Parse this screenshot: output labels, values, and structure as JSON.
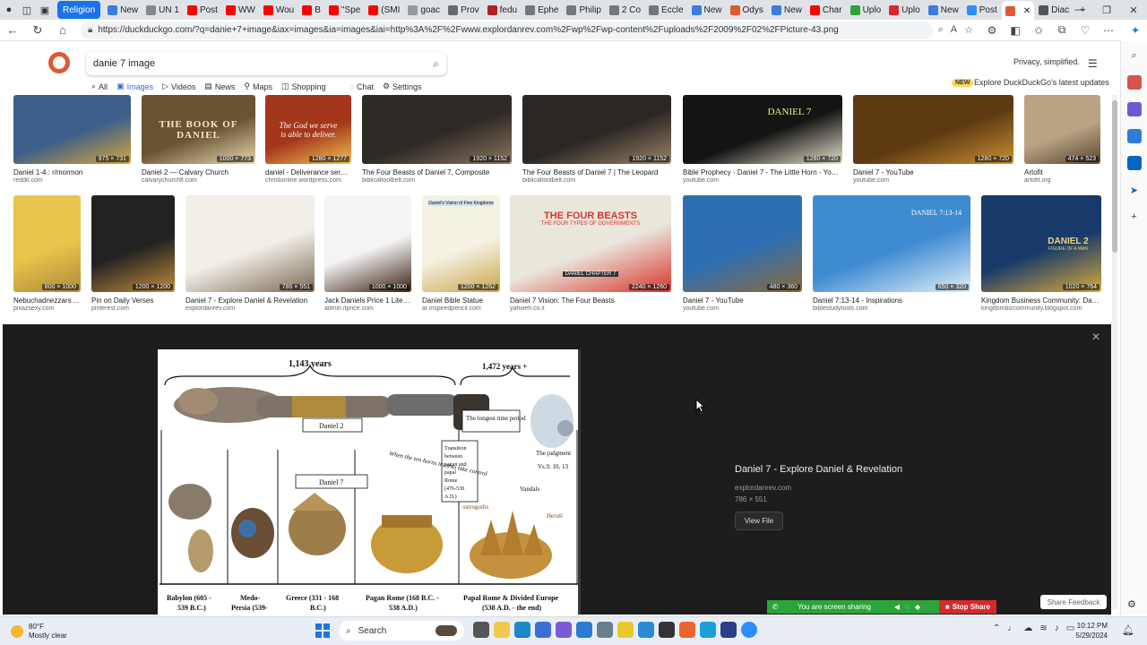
{
  "browser": {
    "tabs": [
      {
        "label": "Religion",
        "type": "group"
      },
      {
        "label": "New",
        "fav": "#3b7ddd"
      },
      {
        "label": "UN 1",
        "fav": "#888"
      },
      {
        "label": "Post",
        "fav": "#ff0000"
      },
      {
        "label": "WW",
        "fav": "#ff0000"
      },
      {
        "label": "Wou",
        "fav": "#ff0000"
      },
      {
        "label": "B",
        "fav": "#ff0000"
      },
      {
        "label": "\"Spe",
        "fav": "#ff0000"
      },
      {
        "label": "(SMI",
        "fav": "#ff0000"
      },
      {
        "label": "goac",
        "fav": "#999"
      },
      {
        "label": "Prov",
        "fav": "#6b6b6b"
      },
      {
        "label": "fedu",
        "fav": "#b02020"
      },
      {
        "label": "Ephe",
        "fav": "#777"
      },
      {
        "label": "Philip",
        "fav": "#777"
      },
      {
        "label": "2 Co",
        "fav": "#777"
      },
      {
        "label": "Eccle",
        "fav": "#777"
      },
      {
        "label": "New",
        "fav": "#3b7ddd"
      },
      {
        "label": "Odys",
        "fav": "#e05a2b"
      },
      {
        "label": "New",
        "fav": "#3b7ddd"
      },
      {
        "label": "Char",
        "fav": "#ff0000"
      },
      {
        "label": "Uplo",
        "fav": "#2aa53a"
      },
      {
        "label": "Uplo",
        "fav": "#d9272e"
      },
      {
        "label": "New",
        "fav": "#3b7ddd"
      },
      {
        "label": "Post",
        "fav": "#2d8cff"
      },
      {
        "label": "",
        "fav": "#de5833",
        "active": true
      },
      {
        "label": "Diac",
        "fav": "#555"
      }
    ],
    "url": "https://duckduckgo.com/?q=danie+7+image&iax=images&ia=images&iai=http%3A%2F%2Fwww.explordanrev.com%2Fwp%2Fwp-content%2Fuploads%2F2009%2F02%2FPicture-43.png"
  },
  "ddg": {
    "query": "danie 7 image",
    "privacy": "Privacy, simplified.",
    "nav": {
      "all": "All",
      "images": "Images",
      "videos": "Videos",
      "news": "News",
      "maps": "Maps",
      "shopping": "Shopping",
      "chat": "Chat",
      "settings": "Settings"
    },
    "new_badge": "NEW",
    "explore": "Explore DuckDuckGo's latest updates"
  },
  "row1": [
    {
      "title": "Daniel 1-4 : r/mormon",
      "src": "reddit.com",
      "dim": "975 × 731",
      "color": "#3d5f8a",
      "accent": "#d8a63a"
    },
    {
      "title": "Daniel 2 — Calvary Church",
      "src": "calvarychurchfl.com",
      "dim": "1000 × 773",
      "color": "#6a5332",
      "accent": "#e9d9b0"
    },
    {
      "title": "daniel - Deliverance serm...",
      "src": "christonline.wordpress.com",
      "dim": "1280 × 1277",
      "color": "#a4361b",
      "accent": "#f3c252"
    },
    {
      "title": "The Four Beasts of Daniel 7, Composite",
      "src": "biblicaltoolbelt.com",
      "dim": "1920 × 1152",
      "color": "#2e2a25",
      "accent": "#8a7560"
    },
    {
      "title": "The Four Beasts of Daniel 7 | The Leopard",
      "src": "biblicaltoolbelt.com",
      "dim": "1920 × 1152",
      "color": "#2b2824",
      "accent": "#9b8468"
    },
    {
      "title": "Bible Prophecy - Daniel 7 - The Little Horn - YouT...",
      "src": "youtube.com",
      "dim": "1280 × 720",
      "color": "#141414",
      "accent": "#e8e2c8"
    },
    {
      "title": "Daniel 7 - YouTube",
      "src": "youtube.com",
      "dim": "1280 × 720",
      "color": "#5e3a13",
      "accent": "#c9902f"
    },
    {
      "title": "Artofit",
      "src": "artofit.org",
      "dim": "474 × 523",
      "color": "#b9a383",
      "accent": "#5b4630"
    }
  ],
  "row2": [
    {
      "title": "Nebuchadnezzars ...",
      "src": "pixazsexy.com",
      "dim": "800 × 1000",
      "color": "#e8c64b",
      "accent": "#b2893a"
    },
    {
      "title": "Pin on Daily Verses",
      "src": "pinterest.com",
      "dim": "1200 × 1200",
      "color": "#222",
      "accent": "#c28c3b"
    },
    {
      "title": "Daniel 7 - Explore Daniel & Revelation",
      "src": "explordanrev.com",
      "dim": "786 × 551",
      "color": "#f2efe8",
      "accent": "#7a6a55"
    },
    {
      "title": "Jack Daniels Price 1 Liter -...",
      "src": "admin.itprice.com",
      "dim": "1000 × 1000",
      "color": "#f4f4f4",
      "accent": "#3a2010"
    },
    {
      "title": "Daniel Bible Statue",
      "src": "ar.inspiredpencil.com",
      "dim": "1200 × 1262",
      "color": "#f5f1e3",
      "accent": "#c8a64a"
    },
    {
      "title": "Daniel 7 Vision: The Four Beasts",
      "src": "yahweh.co.il",
      "dim": "2240 × 1260",
      "color": "#e9e6dc",
      "accent": "#d8342a"
    },
    {
      "title": "Daniel 7 - YouTube",
      "src": "youtube.com",
      "dim": "480 × 360",
      "color": "#2e6fb3",
      "accent": "#8a6a3a"
    },
    {
      "title": "Daniel 7:13-14 - Inspirations",
      "src": "biblestudytools.com",
      "dim": "650 × 320",
      "color": "#3f8bd2",
      "accent": "#e0eef8"
    },
    {
      "title": "Kingdom Business Community: Dani...",
      "src": "kingdombizcommunity.blogspot.com",
      "dim": "1020 × 764",
      "color": "#173a6a",
      "accent": "#d9a93a"
    }
  ],
  "row1_text": {
    "t2": "THE BOOK OF DANIEL",
    "t3a": "The God we serve",
    "t3b": "is able to deliver.",
    "t6": "DANIEL 7"
  },
  "row2_text": {
    "t6a": "THE FOUR BEASTS",
    "t6b": "THE FOUR TYPES OF GOVERNMENTS",
    "t6c": "DANIEL CHAPTER 7",
    "t8": "DANIEL 7:13-14",
    "t9a": "DANIEL 2",
    "t9b": "FIGURE OF A MAN",
    "t5": "Daniel's Vision of Five Kingdoms"
  },
  "detail": {
    "title": "Daniel 7 - Explore Daniel & Revelation",
    "source": "explordanrev.com",
    "dim": "786 × 551",
    "view_file": "View File",
    "preview": {
      "years_left": "1,143 years",
      "years_right": "1,472 years +",
      "daniel2": "Daniel 2",
      "daniel7": "Daniel 7",
      "longest": "The longest time period",
      "judgment": "The judgment",
      "judgment_ref": "Vs.9, 10, 13",
      "transition": "Transition between pagan and papal Rome (476-538 A.D.)",
      "ten_horns": "When the ten horns tried to take control",
      "vandals": "Vandals",
      "heruli": "Heruli",
      "ostrogoths": "ostrogoths",
      "kingdoms": [
        "Babylon (605 - 539 B.C.)",
        "Medo-Persia (539-",
        "Greece (331 - 168 B.C.)",
        "Pagan Rome (168 B.C. - 538 A.D.)",
        "Papal Rome & Divided Europe (538 A.D. - the end)"
      ]
    }
  },
  "share": {
    "text": "You are screen sharing",
    "stop": "Stop Share",
    "feedback": "Share Feedback"
  },
  "taskbar": {
    "temp": "80°F",
    "weather": "Mostly clear",
    "search": "Search",
    "time": "10:12 PM",
    "date": "5/29/2024"
  }
}
